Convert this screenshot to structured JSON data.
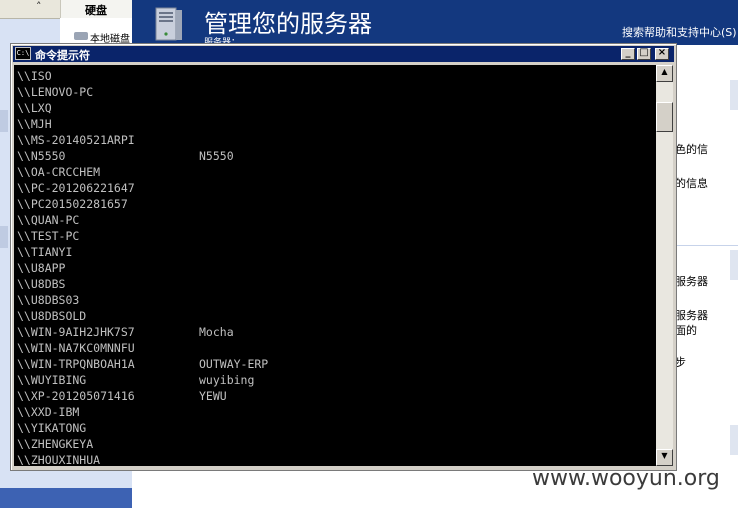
{
  "background_window": {
    "left_panel": {
      "collapse_glyph": "˄",
      "tab_label": "硬盘",
      "drive_label": "本地磁盘"
    },
    "banner": {
      "title": "管理您的服务器",
      "subtitle": "服务器： ",
      "help_link": "搜索帮助和支持中心(S)"
    },
    "right_fragments": [
      "色的信",
      "的信息",
      "服务器",
      "服务器",
      "面的",
      "步"
    ]
  },
  "cmd_window": {
    "title": "命令提示符",
    "icon_text": "C:\\",
    "controls": {
      "minimize": "_",
      "maximize": "□",
      "close": "×"
    },
    "lines": [
      {
        "host": "\\\\ISO",
        "comment": ""
      },
      {
        "host": "\\\\LENOVO-PC",
        "comment": ""
      },
      {
        "host": "\\\\LXQ",
        "comment": ""
      },
      {
        "host": "\\\\MJH",
        "comment": ""
      },
      {
        "host": "\\\\MS-20140521ARPI",
        "comment": ""
      },
      {
        "host": "\\\\N5550",
        "comment": "N5550"
      },
      {
        "host": "\\\\OA-CRCCHEM",
        "comment": ""
      },
      {
        "host": "\\\\PC-201206221647",
        "comment": ""
      },
      {
        "host": "\\\\PC201502281657",
        "comment": ""
      },
      {
        "host": "\\\\QUAN-PC",
        "comment": ""
      },
      {
        "host": "\\\\TEST-PC",
        "comment": ""
      },
      {
        "host": "\\\\TIANYI",
        "comment": ""
      },
      {
        "host": "\\\\U8APP",
        "comment": ""
      },
      {
        "host": "\\\\U8DBS",
        "comment": ""
      },
      {
        "host": "\\\\U8DBS03",
        "comment": ""
      },
      {
        "host": "\\\\U8DBSOLD",
        "comment": ""
      },
      {
        "host": "\\\\WIN-9AIH2JHK7S7",
        "comment": "Mocha"
      },
      {
        "host": "\\\\WIN-NA7KC0MNNFU",
        "comment": ""
      },
      {
        "host": "\\\\WIN-TRPQNBOAH1A",
        "comment": "OUTWAY-ERP"
      },
      {
        "host": "\\\\WUYIBING",
        "comment": "wuyibing"
      },
      {
        "host": "\\\\XP-201205071416",
        "comment": "YEWU"
      },
      {
        "host": "\\\\XXD-IBM",
        "comment": ""
      },
      {
        "host": "\\\\YIKATONG",
        "comment": ""
      },
      {
        "host": "\\\\ZHENGKEYA",
        "comment": ""
      },
      {
        "host": "\\\\ZHOUXINHUA",
        "comment": ""
      }
    ],
    "scrollbar": {
      "up_glyph": "▲",
      "down_glyph": "▼",
      "position": 0.06
    }
  },
  "watermark": "www.wooyun.org"
}
